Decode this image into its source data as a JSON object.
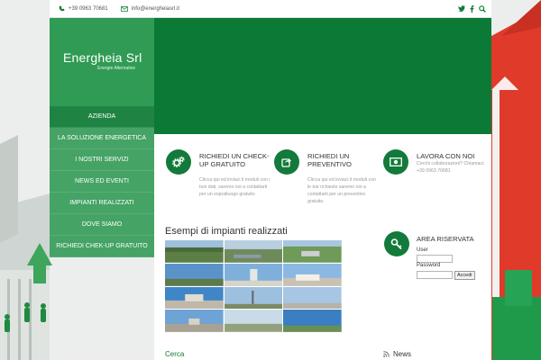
{
  "colors": {
    "brand_green": "#127a3a",
    "logo_green": "#2f9b54",
    "hero_green": "#0b7a36",
    "accent_red": "#e03a2a"
  },
  "topbar": {
    "phone": "+39 0963 70681",
    "email": "info@energheiasrl.it",
    "icons": [
      "phone-icon",
      "mail-icon",
      "twitter-icon",
      "facebook-icon",
      "search-icon"
    ]
  },
  "logo": {
    "name": "Energheia Srl",
    "tagline": "Energie Alternative"
  },
  "nav": {
    "items": [
      "AZIENDA",
      "LA SOLUZIONE ENERGETICA",
      "I NOSTRI SERVIZI",
      "NEWS ED EVENTI",
      "IMPIANTI REALIZZATI",
      "DOVE SIAMO",
      "RICHIEDI CHEK-UP GRATUITO"
    ]
  },
  "features": [
    {
      "title": "RICHIEDI UN CHECK-UP GRATUITO",
      "desc": "Clicca qui ed inviaci il moduli con i tuoi dati, saremo noi a contattarti per un sopralluogo gratuito",
      "icon": "gears-icon"
    },
    {
      "title": "RICHIEDI UN PREVENTIVO",
      "desc": "Clicca qui ed inviaci il moduli con le tue richieste saremo noi a contattarti per un preventivo gratuito.",
      "icon": "share-icon"
    },
    {
      "title": "LAVORA CON NOI",
      "desc": "Cerchi collaborazioni? Chiamaci: +39 0963 70681",
      "icon": "money-icon"
    }
  ],
  "gallery": {
    "title": "Esempi di impianti realizzati",
    "count": 12
  },
  "login": {
    "title": "AREA RISERVATA",
    "user_label": "User",
    "password_label": "Password",
    "submit_label": "Accedi",
    "icon": "key-icon"
  },
  "bottom": {
    "search_label": "Cerca",
    "news_label": "News"
  }
}
